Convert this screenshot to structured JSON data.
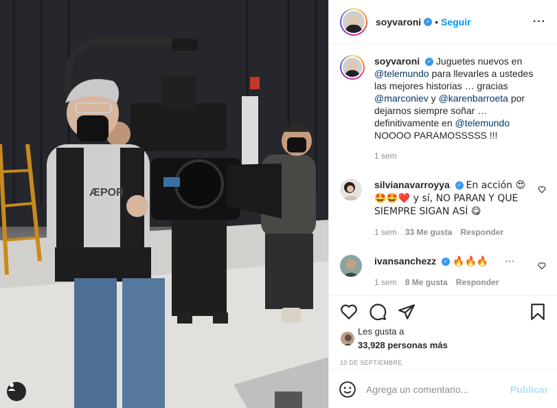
{
  "post": {
    "username": "soyvaroni",
    "follow_label": "Seguir",
    "separator": "•",
    "more_label": "···",
    "caption": {
      "username": "soyvaroni",
      "parts": [
        {
          "t": "Juguetes nuevos en "
        },
        {
          "t": "@telemundo",
          "m": true
        },
        {
          "t": " para llevarles a ustedes las mejores historias … gracias "
        },
        {
          "t": "@marconiev",
          "m": true
        },
        {
          "t": " y "
        },
        {
          "t": "@karenbarroeta",
          "m": true
        },
        {
          "t": " por dejarnos siempre soñar … definitivamente en "
        },
        {
          "t": "@telemundo",
          "m": true
        },
        {
          "t": " NOOOO PARAMOSSSSS !!!"
        }
      ],
      "time": "1 sem"
    },
    "comments": [
      {
        "username": "silvianavarroyya",
        "text": "En acción 😍 🤩🤩❤️ y sí, NO PARAN Y QUE SIEMPRE SIGAN ASÍ 😋",
        "time": "1 sem",
        "likes": "33 Me gusta",
        "reply": "Responder"
      },
      {
        "username": "ivansanchezz",
        "text": "🔥🔥🔥",
        "time": "1 sem",
        "likes": "8 Me gusta",
        "reply": "Responder"
      }
    ],
    "liked_by_prefix": "Les gusta a",
    "liked_by_count": "33,928 personas más",
    "date": "10 DE SEPTIEMBRE",
    "comment_placeholder": "Agrega un comentario...",
    "publish_label": "Publicar"
  },
  "icons": {
    "like": "heart-icon",
    "comment": "comment-icon",
    "share": "share-icon",
    "save": "bookmark-icon",
    "emoji": "emoji-icon",
    "tagged": "user-tag-icon"
  },
  "colors": {
    "accent": "#0095f6",
    "publish_disabled": "#b2dffc",
    "verified": "#3897f0",
    "mention": "#00376b",
    "meta": "#8e8e8e"
  }
}
